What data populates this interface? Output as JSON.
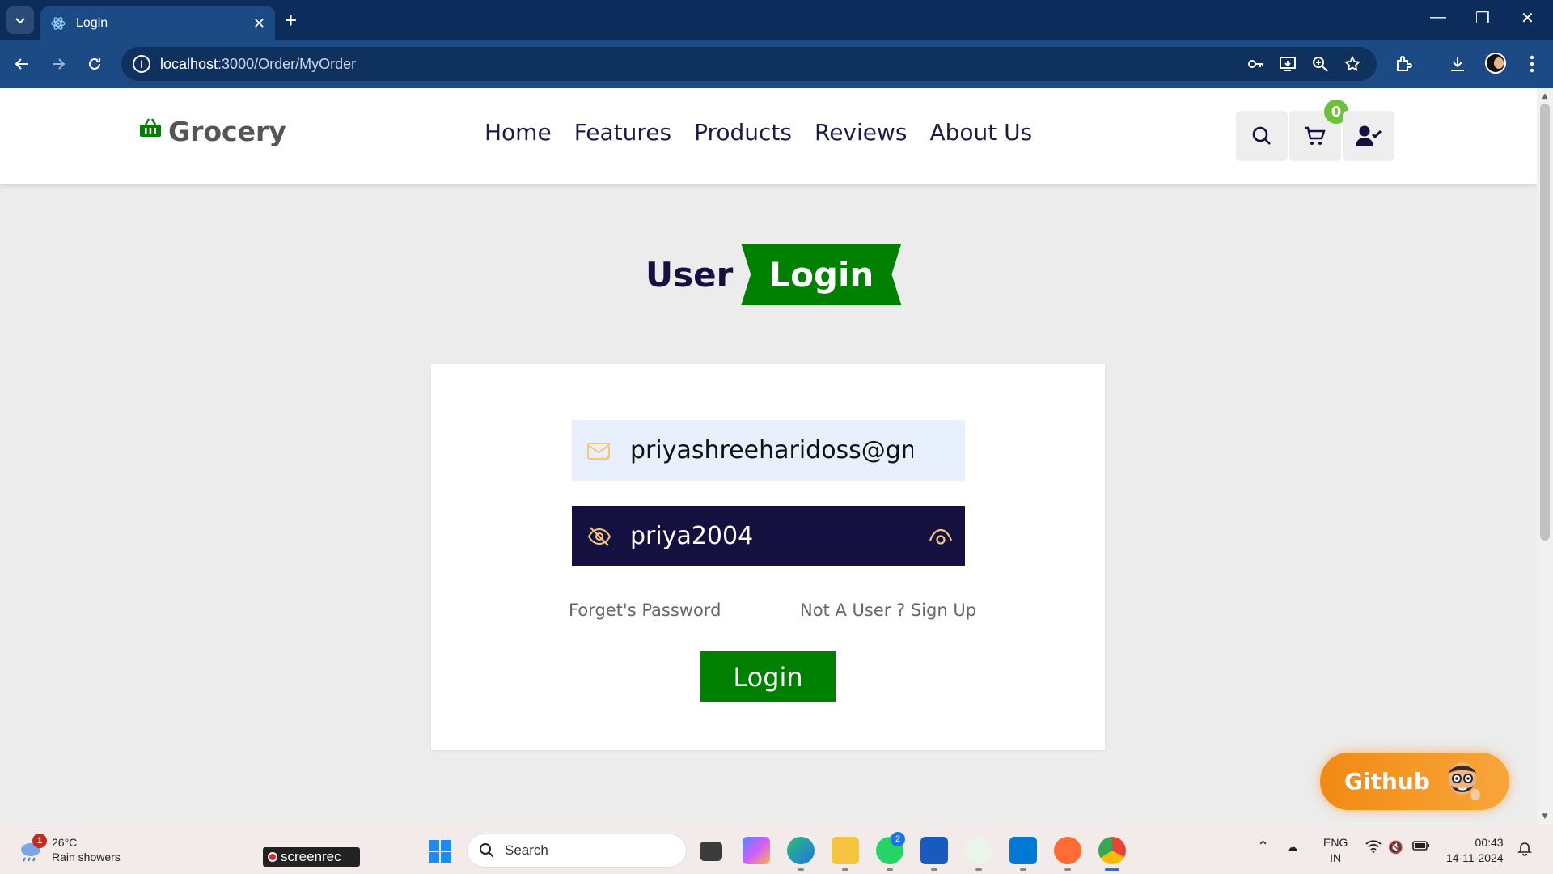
{
  "browser": {
    "tab_title": "Login",
    "new_tab": "+",
    "url_host": "localhost",
    "url_path": ":3000/Order/MyOrder",
    "window_controls": [
      "minimize-icon",
      "restore-icon",
      "close-icon"
    ]
  },
  "site": {
    "logo_text": "Grocery",
    "nav": [
      "Home",
      "Features",
      "Products",
      "Reviews",
      "About Us"
    ],
    "cart_count": "0"
  },
  "login": {
    "heading_user": "User",
    "heading_login": "Login",
    "email_value": "priyashreeharidoss@gmail.com",
    "password_value": "priya2004",
    "forgot_link": "Forget's Password",
    "signup_link": "Not A User ? Sign Up",
    "submit_label": "Login"
  },
  "floating": {
    "github_label": "Github"
  },
  "taskbar": {
    "weather_badge": "1",
    "weather_temp": "26°C",
    "weather_desc": "Rain showers",
    "screenrec_label": "screenrec",
    "search_placeholder": "Search",
    "whatsapp_badge": "2",
    "lang_top": "ENG",
    "lang_bottom": "IN",
    "time": "00:43",
    "date": "14-11-2024"
  },
  "colors": {
    "brand_green": "#008000",
    "navy": "#141040",
    "github_orange": "#f28a14",
    "chrome_blue": "#1c4a84"
  }
}
